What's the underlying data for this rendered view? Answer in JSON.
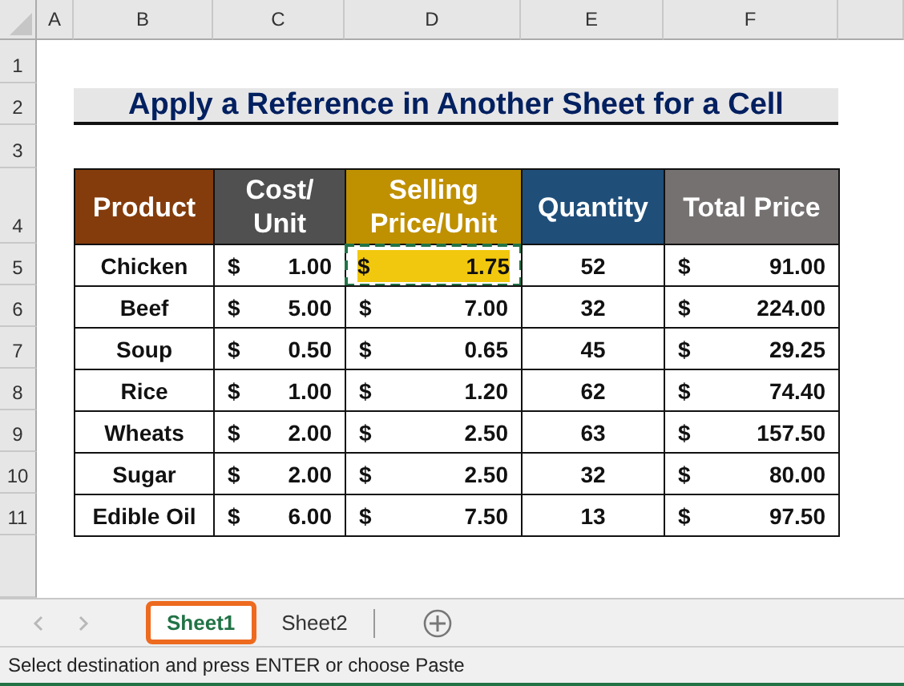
{
  "column_headers": [
    "A",
    "B",
    "C",
    "D",
    "E",
    "F"
  ],
  "row_headers": [
    "1",
    "2",
    "3",
    "4",
    "5",
    "6",
    "7",
    "8",
    "9",
    "10",
    "11"
  ],
  "title": "Apply a Reference in Another Sheet for a Cell",
  "table": {
    "columns": [
      {
        "lines": [
          "Product"
        ],
        "color": "#843c0c"
      },
      {
        "lines": [
          "Cost/",
          "Unit"
        ],
        "color": "#505050"
      },
      {
        "lines": [
          "Selling",
          "Price/Unit"
        ],
        "color": "#bf9000"
      },
      {
        "lines": [
          "Quantity"
        ],
        "color": "#1f4e79"
      },
      {
        "lines": [
          "Total Price"
        ],
        "color": "#767171"
      }
    ],
    "rows": [
      {
        "product": "Chicken",
        "cost": {
          "symbol": "$",
          "amount": "1.00"
        },
        "selling": {
          "symbol": "$",
          "amount": "1.75",
          "copied": true
        },
        "quantity": "52",
        "total": {
          "symbol": "$",
          "amount": "91.00"
        }
      },
      {
        "product": "Beef",
        "cost": {
          "symbol": "$",
          "amount": "5.00"
        },
        "selling": {
          "symbol": "$",
          "amount": "7.00",
          "copied": false
        },
        "quantity": "32",
        "total": {
          "symbol": "$",
          "amount": "224.00"
        }
      },
      {
        "product": "Soup",
        "cost": {
          "symbol": "$",
          "amount": "0.50"
        },
        "selling": {
          "symbol": "$",
          "amount": "0.65",
          "copied": false
        },
        "quantity": "45",
        "total": {
          "symbol": "$",
          "amount": "29.25"
        }
      },
      {
        "product": "Rice",
        "cost": {
          "symbol": "$",
          "amount": "1.00"
        },
        "selling": {
          "symbol": "$",
          "amount": "1.20",
          "copied": false
        },
        "quantity": "62",
        "total": {
          "symbol": "$",
          "amount": "74.40"
        }
      },
      {
        "product": "Wheats",
        "cost": {
          "symbol": "$",
          "amount": "2.00"
        },
        "selling": {
          "symbol": "$",
          "amount": "2.50",
          "copied": false
        },
        "quantity": "63",
        "total": {
          "symbol": "$",
          "amount": "157.50"
        }
      },
      {
        "product": "Sugar",
        "cost": {
          "symbol": "$",
          "amount": "2.00"
        },
        "selling": {
          "symbol": "$",
          "amount": "2.50",
          "copied": false
        },
        "quantity": "32",
        "total": {
          "symbol": "$",
          "amount": "80.00"
        }
      },
      {
        "product": "Edible Oil",
        "cost": {
          "symbol": "$",
          "amount": "6.00"
        },
        "selling": {
          "symbol": "$",
          "amount": "7.50",
          "copied": false
        },
        "quantity": "13",
        "total": {
          "symbol": "$",
          "amount": "97.50"
        }
      }
    ]
  },
  "sheet_tabs": [
    {
      "label": "Sheet1",
      "selected": true
    },
    {
      "label": "Sheet2",
      "selected": false
    }
  ],
  "status_bar": "Select destination and press ENTER or choose Paste"
}
